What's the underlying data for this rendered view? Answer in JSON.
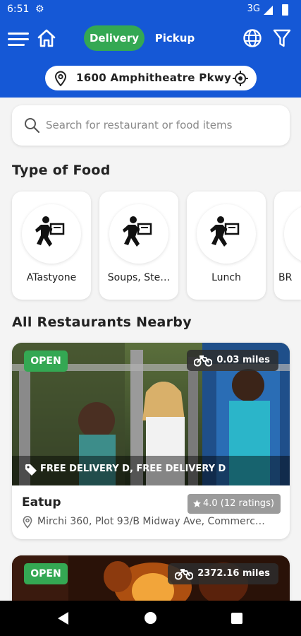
{
  "status_bar": {
    "time": "6:51",
    "network": "3G"
  },
  "header": {
    "tabs": [
      {
        "label": "Delivery",
        "active": true
      },
      {
        "label": "Pickup",
        "active": false
      }
    ],
    "location": "1600 Amphitheatre Pkwy"
  },
  "search": {
    "placeholder": "Search for restaurant or food items",
    "value": ""
  },
  "food_types": {
    "title": "Type of Food",
    "items": [
      {
        "label": "ATastyone"
      },
      {
        "label": "Soups, Ste…"
      },
      {
        "label": "Lunch"
      },
      {
        "label": "BR"
      }
    ]
  },
  "restaurants": {
    "title": "All Restaurants Nearby",
    "items": [
      {
        "status": "OPEN",
        "distance": "0.03 miles",
        "promo": "FREE DELIVERY D, FREE DELIVERY D",
        "name": "Eatup",
        "rating": "4.0 (12 ratings)",
        "address": "Mirchi 360, Plot 93/B Midway Ave, Commerc…"
      },
      {
        "status": "OPEN",
        "distance": "2372.16 miles"
      }
    ]
  },
  "colors": {
    "brand_blue": "#1558d6",
    "open_green": "#34a853"
  }
}
